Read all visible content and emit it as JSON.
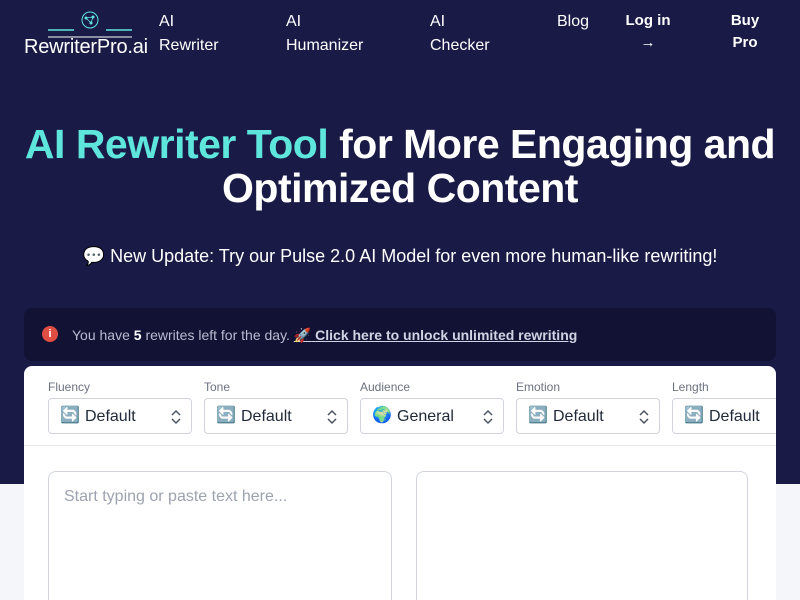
{
  "header": {
    "logo_text": "RewriterPro.ai",
    "nav": [
      {
        "line1": "AI",
        "line2": "Rewriter"
      },
      {
        "line1": "AI",
        "line2": "Humanizer"
      },
      {
        "line1": "AI",
        "line2": "Checker"
      },
      {
        "line1": "Blog",
        "line2": ""
      }
    ],
    "login": {
      "line1": "Log in",
      "line2": "→"
    },
    "buy": {
      "line1": "Buy",
      "line2": "Pro"
    }
  },
  "hero": {
    "headline_accent": "AI Rewriter Tool",
    "headline_rest": " for More Engaging and Optimized Content",
    "update_emoji": "💬",
    "update_text": "New Update: Try our Pulse 2.0 AI Model for even more human-like rewriting!"
  },
  "notice": {
    "icon": "i",
    "text_before": "You have ",
    "count": "5",
    "text_after": " rewrites left for the day. ",
    "link_emoji": "🚀",
    "link_text": "Click here to unlock unlimited rewriting"
  },
  "controls": [
    {
      "label": "Fluency",
      "emoji": "🔄",
      "value": "Default"
    },
    {
      "label": "Tone",
      "emoji": "🔄",
      "value": "Default"
    },
    {
      "label": "Audience",
      "emoji": "🌍",
      "value": "General"
    },
    {
      "label": "Emotion",
      "emoji": "🔄",
      "value": "Default"
    },
    {
      "label": "Length",
      "emoji": "🔄",
      "value": "Default"
    }
  ],
  "editor": {
    "input_placeholder": "Start typing or paste text here..."
  },
  "colors": {
    "hero_bg": "#1a1a47",
    "accent": "#5ee6dd",
    "notice_bg": "#121235",
    "alert_red": "#e04d43"
  }
}
